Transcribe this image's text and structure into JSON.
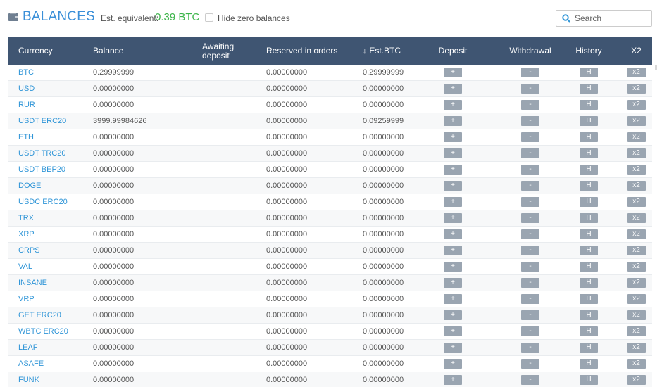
{
  "header": {
    "title": "BALANCES",
    "est_label": "Est. equivalent:",
    "est_value": "0.39 BTC",
    "hide_zero_label": "Hide zero balances",
    "search_placeholder": "Search"
  },
  "table": {
    "columns": [
      "Currency",
      "Balance",
      "Awaiting deposit",
      "Reserved in orders",
      "↓ Est.BTC",
      "Deposit",
      "Withdrawal",
      "History",
      "X2"
    ],
    "awaiting_line1": "Awaiting",
    "awaiting_line2": "deposit",
    "buttons": {
      "deposit": "+",
      "withdrawal": "-",
      "history": "H",
      "x2": "x2"
    },
    "rows": [
      {
        "currency": "BTC",
        "balance": "0.29999999",
        "reserved": "0.00000000",
        "est_btc": "0.29999999"
      },
      {
        "currency": "USD",
        "balance": "0.00000000",
        "reserved": "0.00000000",
        "est_btc": "0.00000000"
      },
      {
        "currency": "RUR",
        "balance": "0.00000000",
        "reserved": "0.00000000",
        "est_btc": "0.00000000"
      },
      {
        "currency": "USDT ERC20",
        "balance": "3999.99984626",
        "reserved": "0.00000000",
        "est_btc": "0.09259999"
      },
      {
        "currency": "ETH",
        "balance": "0.00000000",
        "reserved": "0.00000000",
        "est_btc": "0.00000000"
      },
      {
        "currency": "USDT TRC20",
        "balance": "0.00000000",
        "reserved": "0.00000000",
        "est_btc": "0.00000000"
      },
      {
        "currency": "USDT BEP20",
        "balance": "0.00000000",
        "reserved": "0.00000000",
        "est_btc": "0.00000000"
      },
      {
        "currency": "DOGE",
        "balance": "0.00000000",
        "reserved": "0.00000000",
        "est_btc": "0.00000000"
      },
      {
        "currency": "USDC ERC20",
        "balance": "0.00000000",
        "reserved": "0.00000000",
        "est_btc": "0.00000000"
      },
      {
        "currency": "TRX",
        "balance": "0.00000000",
        "reserved": "0.00000000",
        "est_btc": "0.00000000"
      },
      {
        "currency": "XRP",
        "balance": "0.00000000",
        "reserved": "0.00000000",
        "est_btc": "0.00000000"
      },
      {
        "currency": "CRPS",
        "balance": "0.00000000",
        "reserved": "0.00000000",
        "est_btc": "0.00000000"
      },
      {
        "currency": "VAL",
        "balance": "0.00000000",
        "reserved": "0.00000000",
        "est_btc": "0.00000000"
      },
      {
        "currency": "INSANE",
        "balance": "0.00000000",
        "reserved": "0.00000000",
        "est_btc": "0.00000000"
      },
      {
        "currency": "VRP",
        "balance": "0.00000000",
        "reserved": "0.00000000",
        "est_btc": "0.00000000"
      },
      {
        "currency": "GET ERC20",
        "balance": "0.00000000",
        "reserved": "0.00000000",
        "est_btc": "0.00000000"
      },
      {
        "currency": "WBTC ERC20",
        "balance": "0.00000000",
        "reserved": "0.00000000",
        "est_btc": "0.00000000"
      },
      {
        "currency": "LEAF",
        "balance": "0.00000000",
        "reserved": "0.00000000",
        "est_btc": "0.00000000"
      },
      {
        "currency": "ASAFE",
        "balance": "0.00000000",
        "reserved": "0.00000000",
        "est_btc": "0.00000000"
      },
      {
        "currency": "FUNK",
        "balance": "0.00000000",
        "reserved": "0.00000000",
        "est_btc": "0.00000000"
      }
    ]
  },
  "colors": {
    "accent": "#3a8fd8",
    "header_bg": "#3f5572",
    "est_green": "#3cb44a",
    "button_gray": "#9aa5b1"
  }
}
